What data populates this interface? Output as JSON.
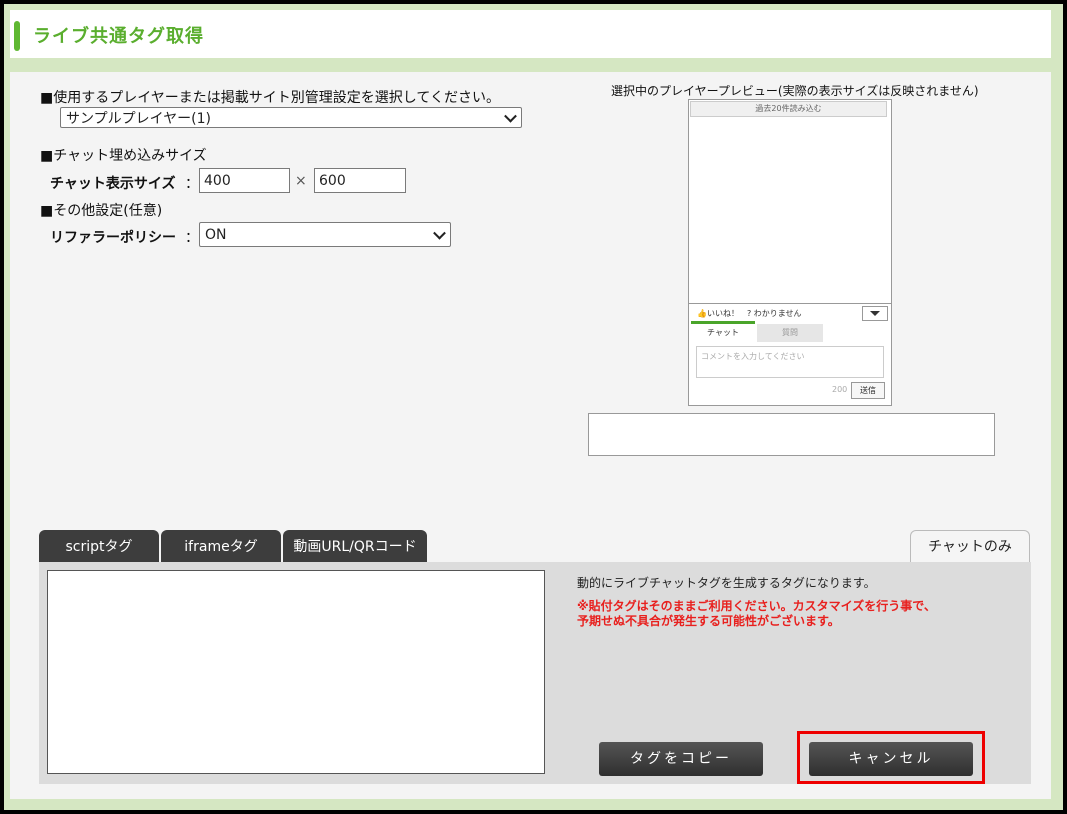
{
  "header": {
    "title": "ライブ共通タグ取得"
  },
  "settings": {
    "player_heading": "■使用するプレイヤーまたは掲載サイト別管理設定を選択してください。",
    "player_selected": "サンプルプレイヤー(1)",
    "size_heading": "■チャット埋め込みサイズ",
    "size_label": "チャット表示サイズ",
    "colon": "：",
    "width": "400",
    "times": "×",
    "height": "600",
    "other_heading": "■その他設定(任意)",
    "referrer_label": "リファラーポリシー",
    "referrer_selected": "ON"
  },
  "preview": {
    "heading": "選択中のプレイヤープレビュー(実際の表示サイズは反映されません)",
    "load_more": "過去20件読み込む",
    "like": "いいね！",
    "dontknow": "わかりません",
    "tab_chat": "チャット",
    "tab_question": "質問",
    "comment_placeholder": "コメントを入力してください",
    "char_count": "200",
    "send": "送信"
  },
  "tabs": {
    "items": [
      "scriptタグ",
      "iframeタグ",
      "動画URL/QRコード"
    ],
    "right": "チャットのみ"
  },
  "content": {
    "description": "動的にライブチャットタグを生成するタグになります。",
    "warning_line1": "※貼付タグはそのままご利用ください。カスタマイズを行う事で、",
    "warning_line2": "予期せぬ不具合が発生する可能性がございます。",
    "copy_button": "タグをコピー",
    "cancel_button": "キャンセル"
  },
  "colors": {
    "accent": "#5fb832",
    "frame": "#d5e7c2",
    "warning": "#e8201e",
    "highlight": "#ee0000"
  }
}
